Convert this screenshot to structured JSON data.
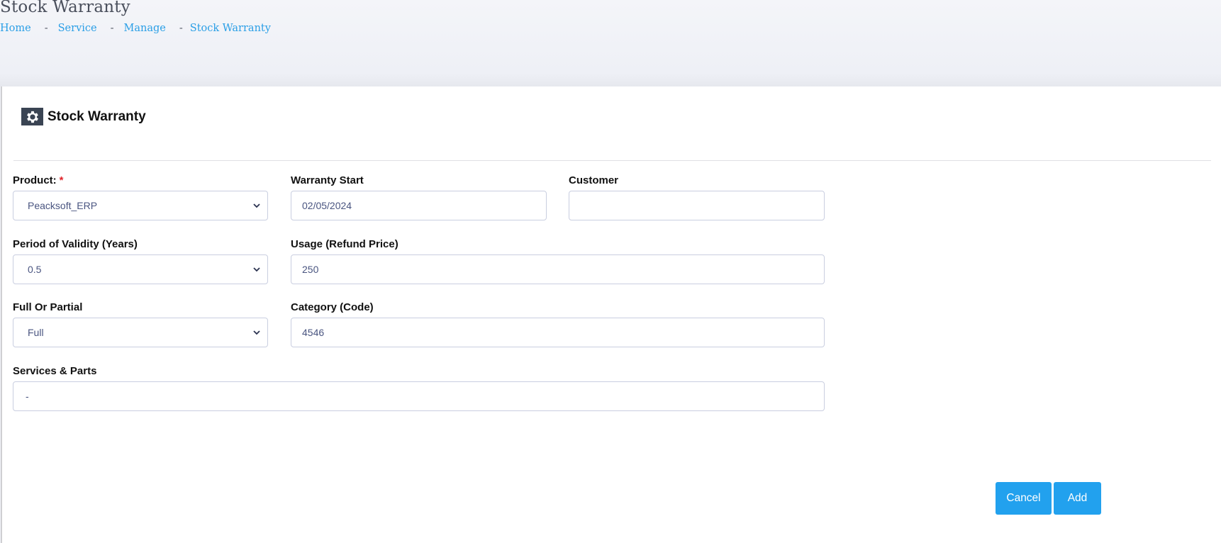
{
  "header": {
    "title": "Stock Warranty",
    "breadcrumb": [
      "Home",
      "Service",
      "Manage",
      "Stock Warranty"
    ],
    "separator": "-"
  },
  "card": {
    "icon": "gear-icon",
    "title": "Stock Warranty"
  },
  "form": {
    "product": {
      "label": "Product:",
      "required_mark": "*",
      "value": "Peacksoft_ERP"
    },
    "warranty_start": {
      "label": "Warranty Start",
      "value": "02/05/2024"
    },
    "customer": {
      "label": "Customer",
      "value": ""
    },
    "period_of_validity": {
      "label": "Period of Validity (Years)",
      "value": "0.5"
    },
    "usage": {
      "label": "Usage (Refund Price)",
      "value": "250"
    },
    "full_or_partial": {
      "label": "Full Or Partial",
      "value": "Full"
    },
    "category": {
      "label": "Category (Code)",
      "value": "4546"
    },
    "services_parts": {
      "label": "Services & Parts",
      "value": "-"
    }
  },
  "actions": {
    "cancel_label": "Cancel",
    "add_label": "Add",
    "button_color": "#22a1ee"
  }
}
